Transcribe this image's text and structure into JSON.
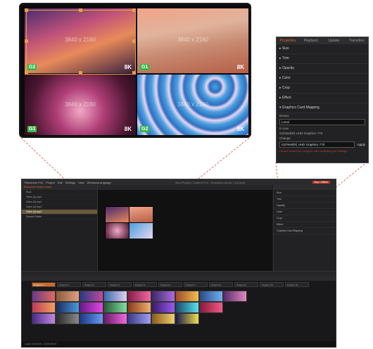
{
  "preview": {
    "tiles": [
      {
        "label": "3840 x 2160",
        "resolution": "8K",
        "badge": "G2"
      },
      {
        "label": "3840 x 2160",
        "resolution": "8K",
        "badge": "G1"
      },
      {
        "label": "3840 x 2160",
        "resolution": "8K",
        "badge": "G1"
      },
      {
        "label": "3840 x 2160",
        "resolution": "8K",
        "badge": "G2"
      }
    ]
  },
  "properties": {
    "tabs": [
      "Properties",
      "Playback",
      "Update",
      "Transition"
    ],
    "sections": [
      "Size",
      "Trim",
      "Opacity",
      "Color",
      "Crop",
      "Effect",
      "Graphics Card Mapping"
    ],
    "device_label": "Device",
    "device_value": "Local",
    "in_use_label": "In Use",
    "in_use_value": "GZ/Intel(R) UHD Graphics 770",
    "change_label": "Change",
    "change_value": "GZ/Intel(R) UHD Graphics 770",
    "apply_label": "Apply",
    "warning": "Please restart the program after modifying the settings"
  },
  "app": {
    "menu": [
      "Resolume P10",
      "Project",
      "Edit",
      "Settings",
      "View",
      "WindowsLanguage"
    ],
    "title": "New Project / Untitled P10 - Resolume Arena 7.15 (x64)",
    "account_button": "Buy / Offline",
    "left_tabs": "Resources  Project Folder",
    "left_rows": [
      "Root",
      "Video (1).mp4",
      "Video (2).mp4",
      "Video (3).mp4",
      "Video (4).mp4",
      "Shared Folder"
    ],
    "right_rows": [
      "Size",
      "Trim",
      "Opacity",
      "Color",
      "Crop",
      "Effect",
      "Graphics Card Mapping"
    ],
    "layers": [
      "Layer",
      "Program 1",
      "Program 2",
      "Program 3",
      "Program 4",
      "Program 5",
      "Program 6",
      "Program 7",
      "Program 8",
      "Program 9",
      "Program 10",
      "Program 11"
    ],
    "status": "Local: 00:00:00 / 23:59:59:00"
  },
  "colors": {
    "accent": "#e06030",
    "selection": "#e8a040",
    "badge": "#39b54a"
  }
}
